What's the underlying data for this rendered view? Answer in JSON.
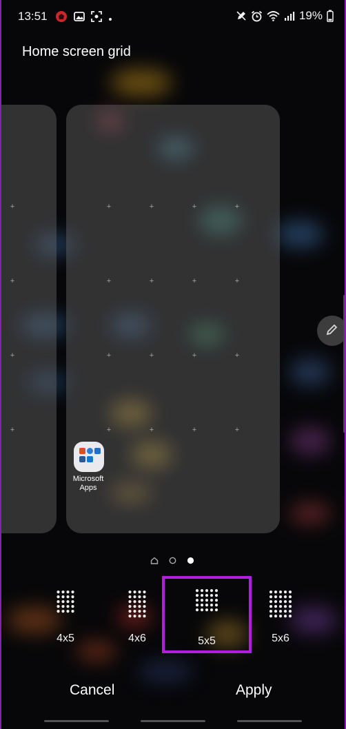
{
  "status_bar": {
    "time": "13:51",
    "battery": "19%"
  },
  "screen": {
    "title": "Home screen grid"
  },
  "app": {
    "label": "Microsoft Apps"
  },
  "grid_options": [
    {
      "label": "4x5",
      "cols": 4,
      "rows": 5,
      "selected": false
    },
    {
      "label": "4x6",
      "cols": 4,
      "rows": 6,
      "selected": false
    },
    {
      "label": "5x5",
      "cols": 5,
      "rows": 5,
      "selected": true
    },
    {
      "label": "5x6",
      "cols": 5,
      "rows": 6,
      "selected": false
    }
  ],
  "page_indicator": {
    "pages": 2,
    "current": 2,
    "has_home": true
  },
  "actions": {
    "cancel": "Cancel",
    "apply": "Apply"
  },
  "colors": {
    "accent": "#b21de0",
    "frame": "#8a1fb8"
  }
}
